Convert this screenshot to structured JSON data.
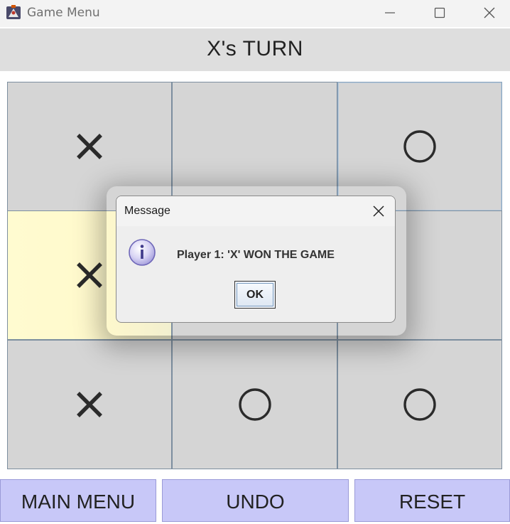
{
  "window": {
    "title": "Game Menu",
    "icon": "java-app-icon"
  },
  "header": {
    "turn_text": "X's TURN"
  },
  "board": {
    "cells": [
      {
        "mark": "X",
        "highlight": false,
        "selected": false
      },
      {
        "mark": "",
        "highlight": false,
        "selected": false
      },
      {
        "mark": "O",
        "highlight": false,
        "selected": true
      },
      {
        "mark": "X",
        "highlight": true,
        "selected": false
      },
      {
        "mark": "",
        "highlight": false,
        "selected": false
      },
      {
        "mark": "",
        "highlight": false,
        "selected": false
      },
      {
        "mark": "X",
        "highlight": false,
        "selected": false
      },
      {
        "mark": "O",
        "highlight": false,
        "selected": false
      },
      {
        "mark": "O",
        "highlight": false,
        "selected": false
      }
    ]
  },
  "buttons": {
    "main_menu": "MAIN MENU",
    "undo": "UNDO",
    "reset": "RESET"
  },
  "dialog": {
    "title": "Message",
    "message": "Player 1: 'X' WON THE GAME",
    "ok_label": "OK",
    "icon": "information-icon"
  },
  "colors": {
    "cell_background": "#d5d5d5",
    "highlight_cell": "#fffbd0",
    "button_background": "#c8c8f8",
    "mark_color": "#2b2b2b"
  }
}
